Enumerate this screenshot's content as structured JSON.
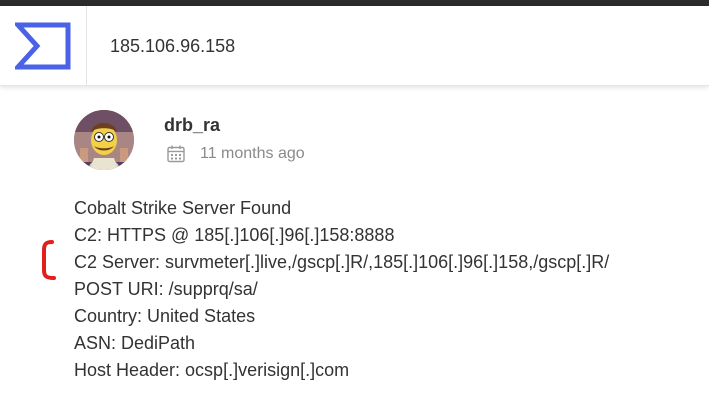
{
  "search": {
    "query": "185.106.96.158"
  },
  "post": {
    "author": "drb_ra",
    "timestamp": "11 months ago",
    "lines": [
      "Cobalt Strike Server Found",
      "C2: HTTPS @ 185[.]106[.]96[.]158:8888",
      "C2 Server: survmeter[.]live,/gscp[.]R/,185[.]106[.]96[.]158,/gscp[.]R/",
      "POST URI: /supprq/sa/",
      "Country: United States",
      "ASN: DediPath",
      "Host Header: ocsp[.]verisign[.]com"
    ]
  },
  "colors": {
    "logo": "#4a62e6",
    "annotation": "#e0201c",
    "text": "#333333",
    "muted": "#8a8a8a"
  },
  "icons": {
    "logo": "sigma-logo-icon",
    "calendar": "calendar-icon"
  }
}
